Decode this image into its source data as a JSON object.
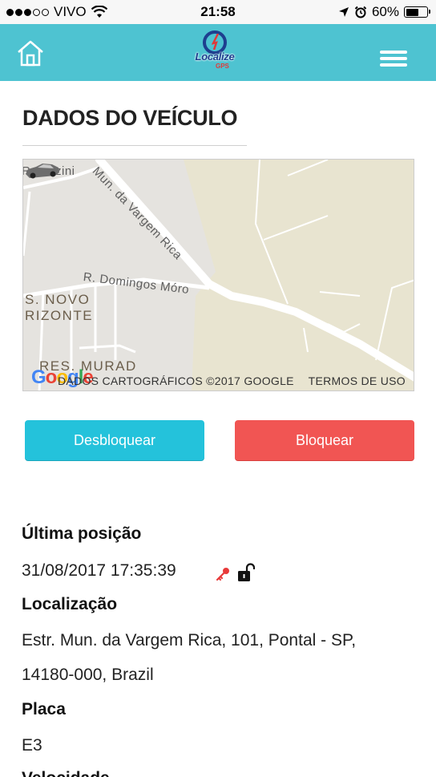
{
  "status_bar": {
    "carrier": "VIVO",
    "time": "21:58",
    "battery": "60%",
    "battery_level": 0.6,
    "signal_bars": 3
  },
  "header": {
    "logo_text": "Localize",
    "logo_sub": "GPS",
    "home_icon": "home-icon",
    "menu_icon": "hamburger-menu-icon"
  },
  "page": {
    "title": "DADOS DO VEÍCULO"
  },
  "map": {
    "streets": {
      "street_1": "Ramazini",
      "street_2": "Mun. da Vargem Rica",
      "street_3": "R. Domingos Móro"
    },
    "area_1": "S. NOVO",
    "area_2": "RIZONTE",
    "area_3": "RES. MURAD",
    "google_logo": "Google",
    "copyright": "DADOS CARTOGRÁFICOS ©2017 GOOGLE",
    "terms": "TERMOS DE USO",
    "colors": {
      "land": "#e5e3df",
      "park": "#e8e4d0",
      "road": "#ffffff"
    }
  },
  "actions": {
    "unlock_label": "Desbloquear",
    "lock_label": "Bloquear",
    "unlock_color": "#24c2db",
    "lock_color": "#f15553"
  },
  "details": {
    "last_position_label": "Última posição",
    "last_position_value": "31/08/2017 17:35:39",
    "ignition_icon": "key-icon",
    "lock_status_icon": "unlocked-padlock-icon",
    "location_label": "Localização",
    "location_line1": "Estr. Mun. da Vargem Rica, 101, Pontal - SP,",
    "location_line2": "14180-000, Brazil",
    "plate_label": "Placa",
    "plate_value": "E3",
    "speed_label": "Velocidade"
  },
  "colors": {
    "header_bg": "#4ec3d1"
  }
}
